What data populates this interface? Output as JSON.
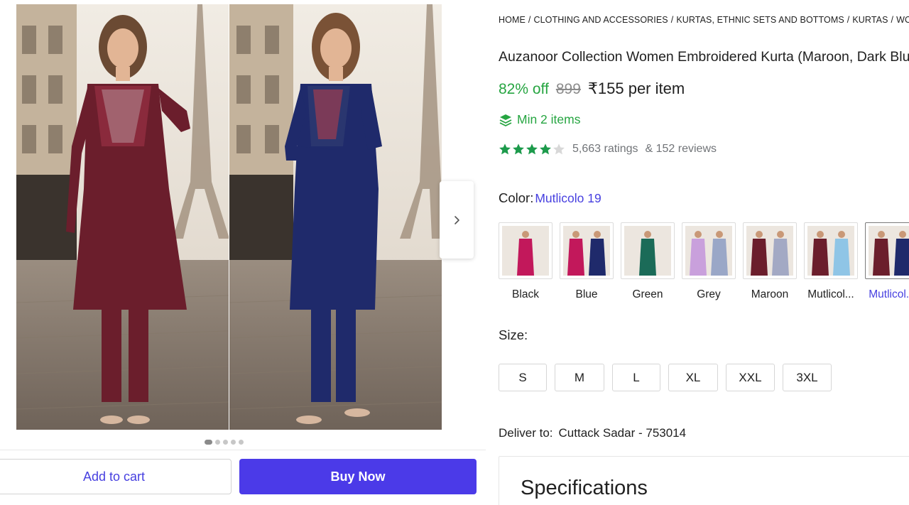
{
  "gallery": {
    "images": [
      {
        "description_icon": "photo-kurta-maroon",
        "color": "#6b1e2c"
      },
      {
        "description_icon": "photo-kurta-navy",
        "color": "#1f2a6b"
      }
    ],
    "next_icon": "chevron-right-icon",
    "dots": 5,
    "active_dot": 0
  },
  "actions": {
    "add_to_cart": "Add to cart",
    "buy_now": "Buy Now"
  },
  "breadcrumb": [
    "HOME",
    "CLOTHING AND ACCESSORIES",
    "KURTAS, ETHNIC SETS AND BOTTOMS",
    "KURTAS",
    "WOMEN KURTAS"
  ],
  "product": {
    "title": "Auzanoor Collection Women Embroidered Kurta (Maroon, Dark Blue)",
    "discount": "82% off",
    "mrp": "899",
    "price": "₹155 per item",
    "min_items": "Min 2 items",
    "rating_value": 4,
    "ratings_text": "5,663 ratings",
    "reviews_text": "& 152 reviews"
  },
  "color": {
    "label": "Color:",
    "selected": "Mutlicolo 19",
    "options": [
      {
        "name": "Black",
        "primary": "#c2185b",
        "secondary": null
      },
      {
        "name": "Blue",
        "primary": "#c2185b",
        "secondary": "#1f2a6b"
      },
      {
        "name": "Green",
        "primary": "#1b6b58",
        "secondary": null
      },
      {
        "name": "Grey",
        "primary": "#c9a0dc",
        "secondary": "#9aa7c7"
      },
      {
        "name": "Maroon",
        "primary": "#6b1e2c",
        "secondary": "#a3a9c4"
      },
      {
        "name": "Mutlicol...",
        "primary": "#6b1e2c",
        "secondary": "#8fc5e6"
      },
      {
        "name": "Mutlicol...",
        "primary": "#6b1e2c",
        "secondary": "#1f2a6b"
      }
    ],
    "selected_index": 6
  },
  "size": {
    "label": "Size:",
    "options": [
      "S",
      "M",
      "L",
      "XL",
      "XXL",
      "3XL"
    ]
  },
  "delivery": {
    "label": "Deliver to:",
    "location": "Cuttack Sadar - 753014"
  },
  "specifications": {
    "title": "Specifications"
  },
  "colors": {
    "accent": "#4740e0",
    "buy_button": "#4b3ae8",
    "discount_green": "#26a541",
    "star_green": "#1c9a4b"
  }
}
